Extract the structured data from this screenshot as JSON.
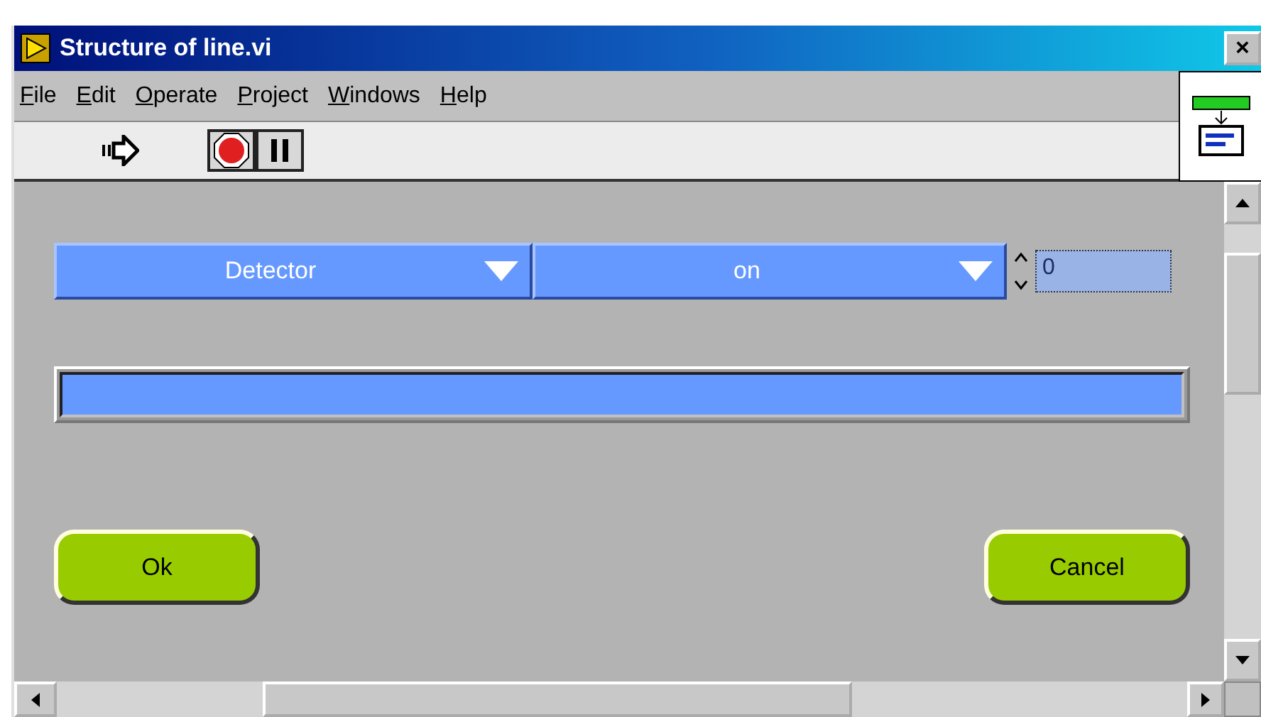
{
  "window": {
    "title": "Structure of line.vi",
    "close": "×"
  },
  "menu": [
    {
      "label": "File"
    },
    {
      "label": "Edit"
    },
    {
      "label": "Operate"
    },
    {
      "label": "Project"
    },
    {
      "label": "Windows"
    },
    {
      "label": "Help"
    }
  ],
  "panel": {
    "rings": [
      {
        "value": "Detector"
      },
      {
        "value": "on"
      }
    ],
    "numeric": {
      "value": "0"
    },
    "buttons": [
      {
        "label": "Ok"
      },
      {
        "label": "Cancel"
      }
    ]
  }
}
